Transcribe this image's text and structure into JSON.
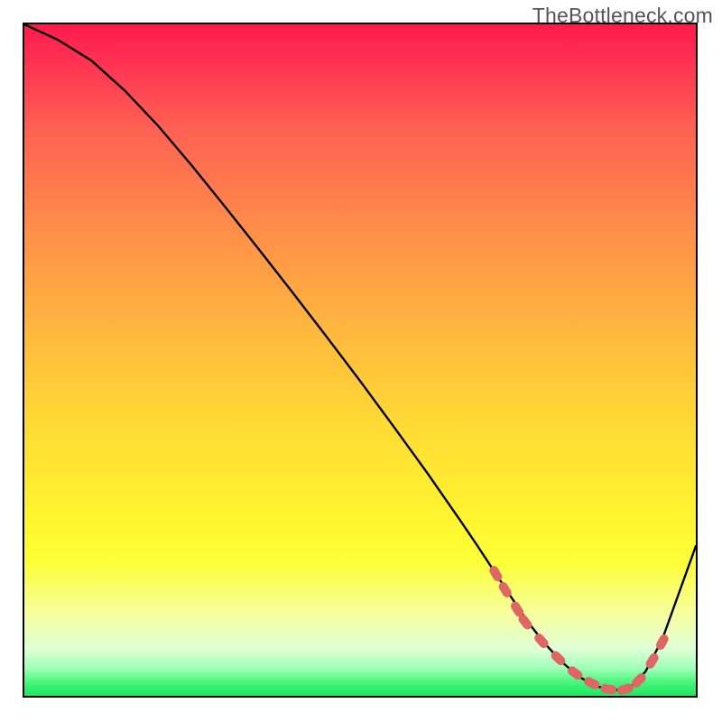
{
  "watermark": "TheBottleneck.com",
  "chart_data": {
    "type": "line",
    "title": "",
    "xlabel": "",
    "ylabel": "",
    "xlim": [
      0,
      100
    ],
    "ylim": [
      0,
      100
    ],
    "grid": false,
    "series": [
      {
        "name": "bottleneck-curve",
        "x": [
          0,
          5,
          10,
          15,
          20,
          25,
          30,
          35,
          40,
          45,
          50,
          55,
          60,
          62.5,
          65,
          67.5,
          70,
          72.5,
          75,
          77.5,
          80,
          82.5,
          85,
          87.5,
          90,
          92.5,
          95,
          100
        ],
        "y": [
          100,
          97.7,
          94.6,
          90.1,
          84.8,
          78.9,
          72.7,
          66.4,
          60.0,
          53.5,
          46.9,
          40.1,
          33.2,
          29.6,
          26.0,
          22.3,
          18.5,
          14.7,
          11.0,
          7.8,
          5.1,
          2.9,
          1.5,
          0.8,
          1.0,
          3.6,
          8.4,
          22.3
        ]
      }
    ],
    "markers": {
      "name": "optimal-range-markers",
      "color": "#e06666",
      "points": [
        {
          "x": 70.2,
          "y": 18.2
        },
        {
          "x": 71.6,
          "y": 15.8
        },
        {
          "x": 73.4,
          "y": 12.9
        },
        {
          "x": 74.6,
          "y": 11.0
        },
        {
          "x": 77.0,
          "y": 8.2
        },
        {
          "x": 79.5,
          "y": 5.6
        },
        {
          "x": 82.0,
          "y": 3.4
        },
        {
          "x": 84.5,
          "y": 1.9
        },
        {
          "x": 87.0,
          "y": 1.0
        },
        {
          "x": 89.5,
          "y": 1.0
        },
        {
          "x": 91.5,
          "y": 2.3
        },
        {
          "x": 93.5,
          "y": 5.2
        },
        {
          "x": 95.0,
          "y": 8.0
        }
      ]
    },
    "gradient": {
      "top_color": "#ff1a4d",
      "mid_color": "#fff22f",
      "bottom_color": "#18e85f"
    }
  }
}
